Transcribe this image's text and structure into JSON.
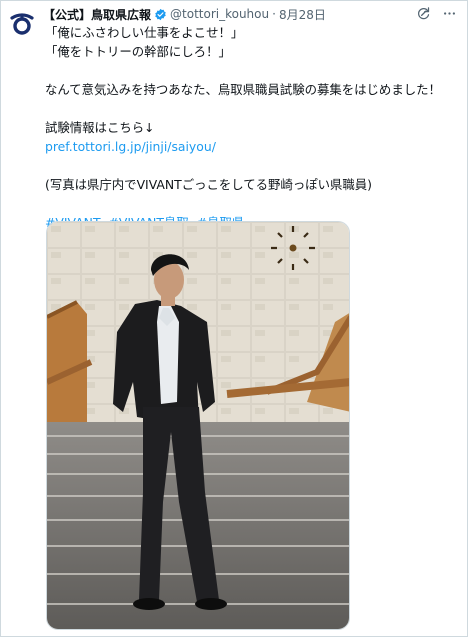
{
  "account": {
    "name": "【公式】鳥取県広報",
    "handle": "@tottori_kouhou",
    "separator": "·",
    "time": "8月28日"
  },
  "icons": {
    "avatar": "tottori-prefecture-logo-icon",
    "verified": "verified-badge-icon",
    "refresh": "grok-refresh-icon",
    "more": "more-dots-icon"
  },
  "tweet": {
    "lines": [
      "「俺にふさわしい仕事をよこせ！」",
      "「俺をトトリーの幹部にしろ！」",
      "",
      "なんて意気込みを持つあなた、鳥取県職員試験の募集をはじめました！",
      "",
      "試験情報はこちら↓"
    ],
    "link": "pref.tottori.lg.jp/jinji/saiyou/",
    "caption": "(写真は県庁内でVIVANTごっこをしてる野崎っぽい県職員)",
    "hashtags": [
      "#VIVANT",
      "#VIVANT鳥取",
      "#鳥取県"
    ]
  },
  "colors": {
    "accent": "#1d9bf0",
    "text": "#0f1419",
    "muted": "#536471",
    "logo": "#1a2f6e",
    "border": "#cfd9de"
  }
}
